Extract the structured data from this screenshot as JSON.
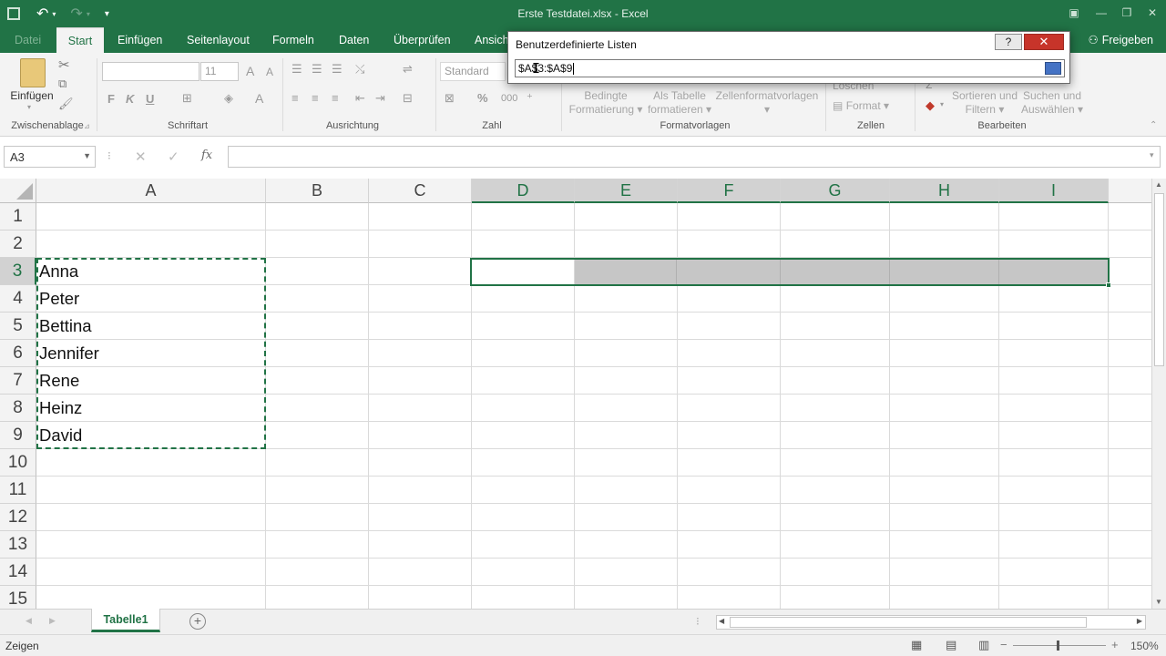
{
  "window": {
    "title": "Erste Testdatei.xlsx - Excel"
  },
  "ribbon_tabs": [
    "Datei",
    "Start",
    "Einfügen",
    "Seitenlayout",
    "Formeln",
    "Daten",
    "Überprüfen",
    "Ansicht"
  ],
  "share_label": "Freigeben",
  "ribbon": {
    "paste_label": "Einfügen",
    "font_size": "11",
    "number_format": "Standard",
    "bold": "F",
    "italic": "K",
    "underline": "U",
    "cond_format_1": "Bedingte",
    "cond_format_2": "Formatierung",
    "as_table_1": "Als Tabelle",
    "as_table_2": "formatieren",
    "cell_styles": "Zellenformatvorlagen",
    "delete_label": "Löschen",
    "format_label": "Format",
    "sort_1": "Sortieren und",
    "sort_2": "Filtern",
    "find_1": "Suchen und",
    "find_2": "Auswählen",
    "groups": {
      "clipboard": "Zwischenablage",
      "font": "Schriftart",
      "alignment": "Ausrichtung",
      "number": "Zahl",
      "styles": "Formatvorlagen",
      "cells": "Zellen",
      "editing": "Bearbeiten"
    }
  },
  "formula_bar": {
    "name_box": "A3",
    "fx": "fx",
    "value": ""
  },
  "grid": {
    "columns": [
      "A",
      "B",
      "C",
      "D",
      "E",
      "F",
      "G",
      "H",
      "I"
    ],
    "rows": [
      "1",
      "2",
      "3",
      "4",
      "5",
      "6",
      "7",
      "8",
      "9",
      "10",
      "11",
      "12",
      "13",
      "14",
      "15"
    ],
    "column_a_values": [
      "Anna",
      "Peter",
      "Bettina",
      "Jennifer",
      "Rene",
      "Heinz",
      "David"
    ]
  },
  "sheet_tabs": [
    "Tabelle1"
  ],
  "status": {
    "mode": "Zeigen",
    "zoom": "150%"
  },
  "dialog": {
    "title": "Benutzerdefinierte Listen",
    "help": "?",
    "close": "✕",
    "input_value": "$A$3:$A$9"
  },
  "colors": {
    "excel_green": "#217346",
    "selection_fill": "#c6c6c6",
    "close_red": "#c7342a"
  }
}
